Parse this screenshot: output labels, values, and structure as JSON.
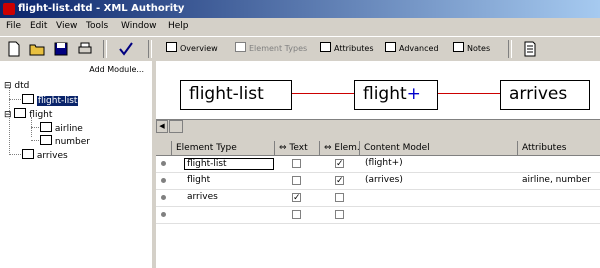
{
  "window": {
    "title": "flight-list.dtd - XML Authority"
  },
  "menu": [
    "File",
    "Edit",
    "View",
    "Tools",
    "Window",
    "Help"
  ],
  "view_buttons": [
    {
      "label": "Overview",
      "enabled": true
    },
    {
      "label": "Element Types",
      "enabled": false
    },
    {
      "label": "Attributes",
      "enabled": true
    },
    {
      "label": "Advanced",
      "enabled": true
    },
    {
      "label": "Notes",
      "enabled": true
    }
  ],
  "sidebar": {
    "add_module_label": "Add Module...",
    "tree": {
      "root": "dtd",
      "nodes": [
        {
          "label": "flight-list",
          "selected": true
        },
        {
          "label": "flight"
        },
        {
          "label": "airline"
        },
        {
          "label": "number"
        },
        {
          "label": "arrives"
        }
      ]
    }
  },
  "canvas": {
    "boxes": [
      {
        "label": "flight-list"
      },
      {
        "label": "flight",
        "suffix": "+"
      },
      {
        "label": "arrives"
      }
    ]
  },
  "grid": {
    "columns": [
      "Element Type",
      "Text",
      "Elem.",
      "Content Model",
      "Attributes"
    ],
    "rows": [
      {
        "name": "flight-list",
        "text": false,
        "elem": true,
        "model": "(flight+)",
        "attrs": "",
        "editing": true
      },
      {
        "name": "flight",
        "text": false,
        "elem": true,
        "model": "(arrives)",
        "attrs": "airline, number"
      },
      {
        "name": "arrives",
        "text": true,
        "elem": false,
        "model": "",
        "attrs": ""
      },
      {
        "name": "",
        "text": false,
        "elem": false,
        "model": "",
        "attrs": ""
      }
    ]
  },
  "colors": {
    "accent_line": "#cc0000",
    "title_bg": "#0a246a",
    "flight_plus": "#0000cc"
  }
}
